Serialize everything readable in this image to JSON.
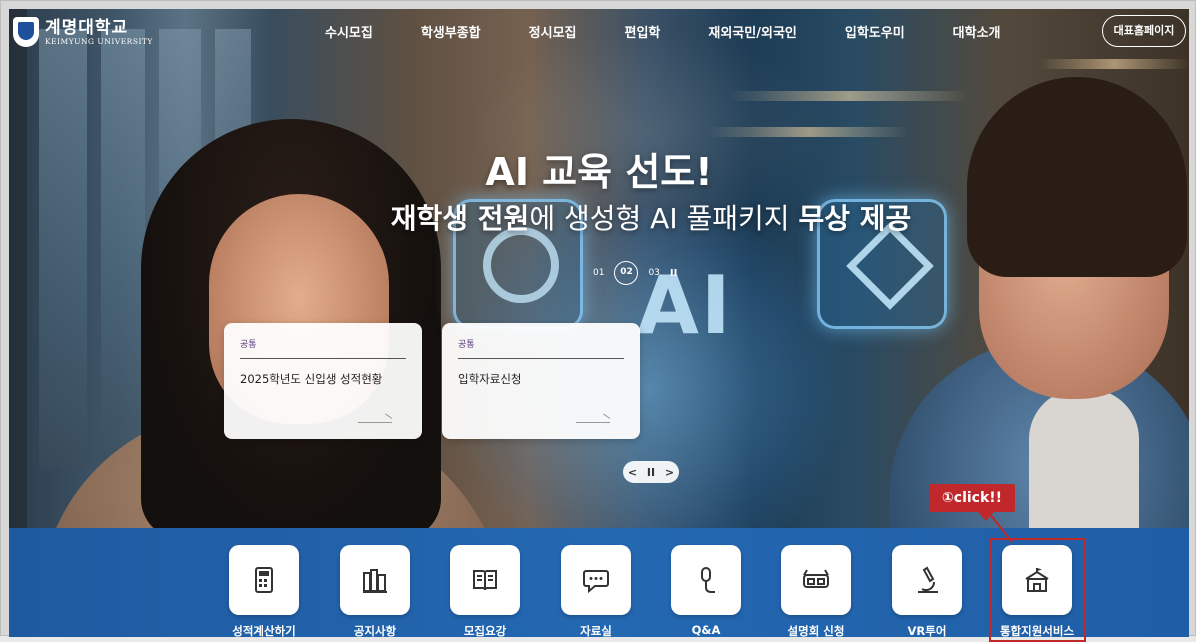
{
  "header": {
    "logo_ko": "계명대학교",
    "logo_en": "KEIMYUNG UNIVERSITY",
    "nav": [
      "수시모집",
      "학생부종합",
      "정시모집",
      "편입학",
      "재외국민/외국인",
      "입학도우미",
      "대학소개"
    ],
    "home_button": "대표홈페이지"
  },
  "hero": {
    "headline": "AI 교육 선도!",
    "sub_part1": "재학생 전원",
    "sub_part2": "에 생성형 AI 풀패키지 ",
    "sub_part3": "무상 제공",
    "tile_text": "AI",
    "pager": {
      "slides": [
        "01",
        "02",
        "03"
      ],
      "active": "02",
      "pause": "II"
    }
  },
  "notices": [
    {
      "tag": "공통",
      "title": "2025학년도 신입생 성적현황"
    },
    {
      "tag": "공통",
      "title": "입학자료신청"
    }
  ],
  "card_pager": {
    "prev": "<",
    "pause": "II",
    "next": ">"
  },
  "quick_links": [
    {
      "label": "성적계산하기",
      "icon": "calculator-icon"
    },
    {
      "label": "공지사항",
      "icon": "books-icon"
    },
    {
      "label": "모집요강",
      "icon": "open-book-icon"
    },
    {
      "label": "자료실",
      "icon": "chat-bubble-icon"
    },
    {
      "label": "Q&A",
      "icon": "microphone-icon"
    },
    {
      "label": "설명회 신청",
      "icon": "vr-glasses-icon"
    },
    {
      "label": "VR투어",
      "icon": "microscope-icon"
    },
    {
      "label": "통합지원서비스",
      "icon": "school-building-icon"
    }
  ],
  "annotation": {
    "callout": "①click!!",
    "color": "#c0282b"
  },
  "colors": {
    "quickbar": "#2468b2",
    "accent": "#c0282b",
    "brand": "#1d4f9a"
  }
}
